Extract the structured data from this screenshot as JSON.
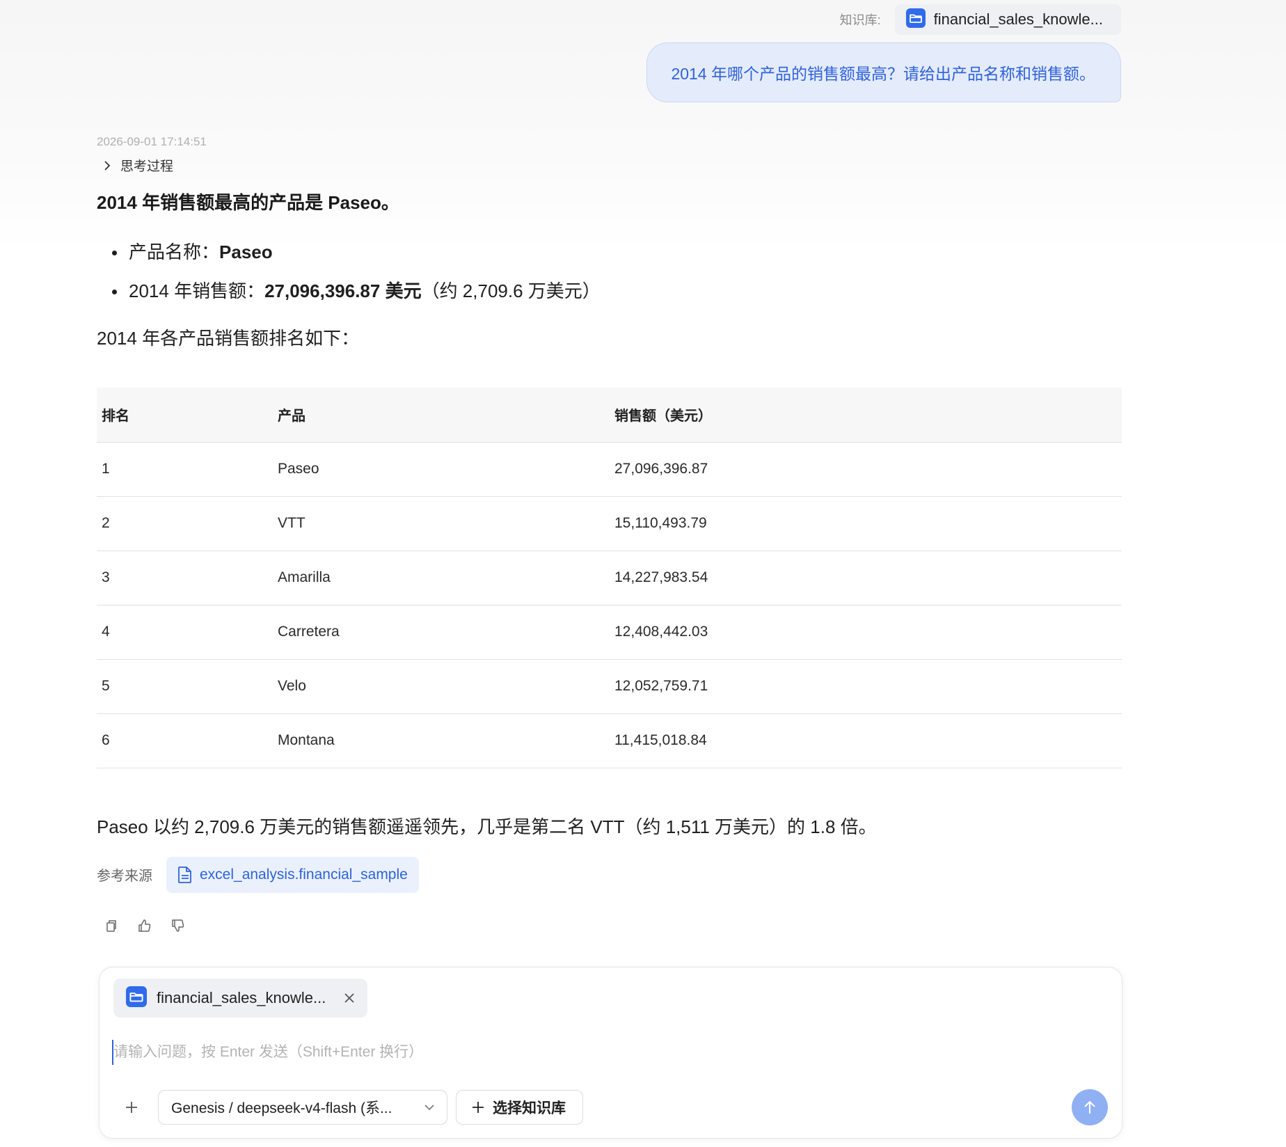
{
  "header": {
    "kb_label": "知识库:",
    "kb_name": "financial_sales_knowle..."
  },
  "user_message": "2014 年哪个产品的销售额最高？请给出产品名称和销售额。",
  "assistant": {
    "timestamp": "2026-09-01 17:14:51",
    "thinking_label": "思考过程",
    "answer_title": "2014 年销售额最高的产品是 Paseo。",
    "bullet1_label": "产品名称：",
    "bullet1_value": "Paseo",
    "bullet2_label": "2014 年销售额：",
    "bullet2_value": "27,096,396.87 美元",
    "bullet2_suffix": "（约 2,709.6 万美元）",
    "ranking_intro": "2014 年各产品销售额排名如下：",
    "table": {
      "headers": [
        "排名",
        "产品",
        "销售额（美元）"
      ],
      "rows": [
        [
          "1",
          "Paseo",
          "27,096,396.87"
        ],
        [
          "2",
          "VTT",
          "15,110,493.79"
        ],
        [
          "3",
          "Amarilla",
          "14,227,983.54"
        ],
        [
          "4",
          "Carretera",
          "12,408,442.03"
        ],
        [
          "5",
          "Velo",
          "12,052,759.71"
        ],
        [
          "6",
          "Montana",
          "11,415,018.84"
        ]
      ]
    },
    "summary": "Paseo 以约 2,709.6 万美元的销售额遥遥领先，几乎是第二名 VTT（约 1,511 万美元）的 1.8 倍。",
    "refs_label": "参考来源",
    "ref_name": "excel_analysis.financial_sample",
    "actions": [
      "copy-icon",
      "thumbs-up-icon",
      "thumbs-down-icon"
    ]
  },
  "composer": {
    "kb_name": "financial_sales_knowle...",
    "placeholder": "请输入问题，按 Enter 发送（Shift+Enter 换行）",
    "model": "Genesis / deepseek-v4-flash (系...",
    "choose_kb": "选择知识库"
  },
  "colors": {
    "accent": "#2f63d8",
    "user_bubble_bg": "#e4ebfb",
    "chip_bg": "#eef0f3",
    "ref_chip_bg": "#eaf1fd",
    "send_btn": "#8fb0f3"
  }
}
